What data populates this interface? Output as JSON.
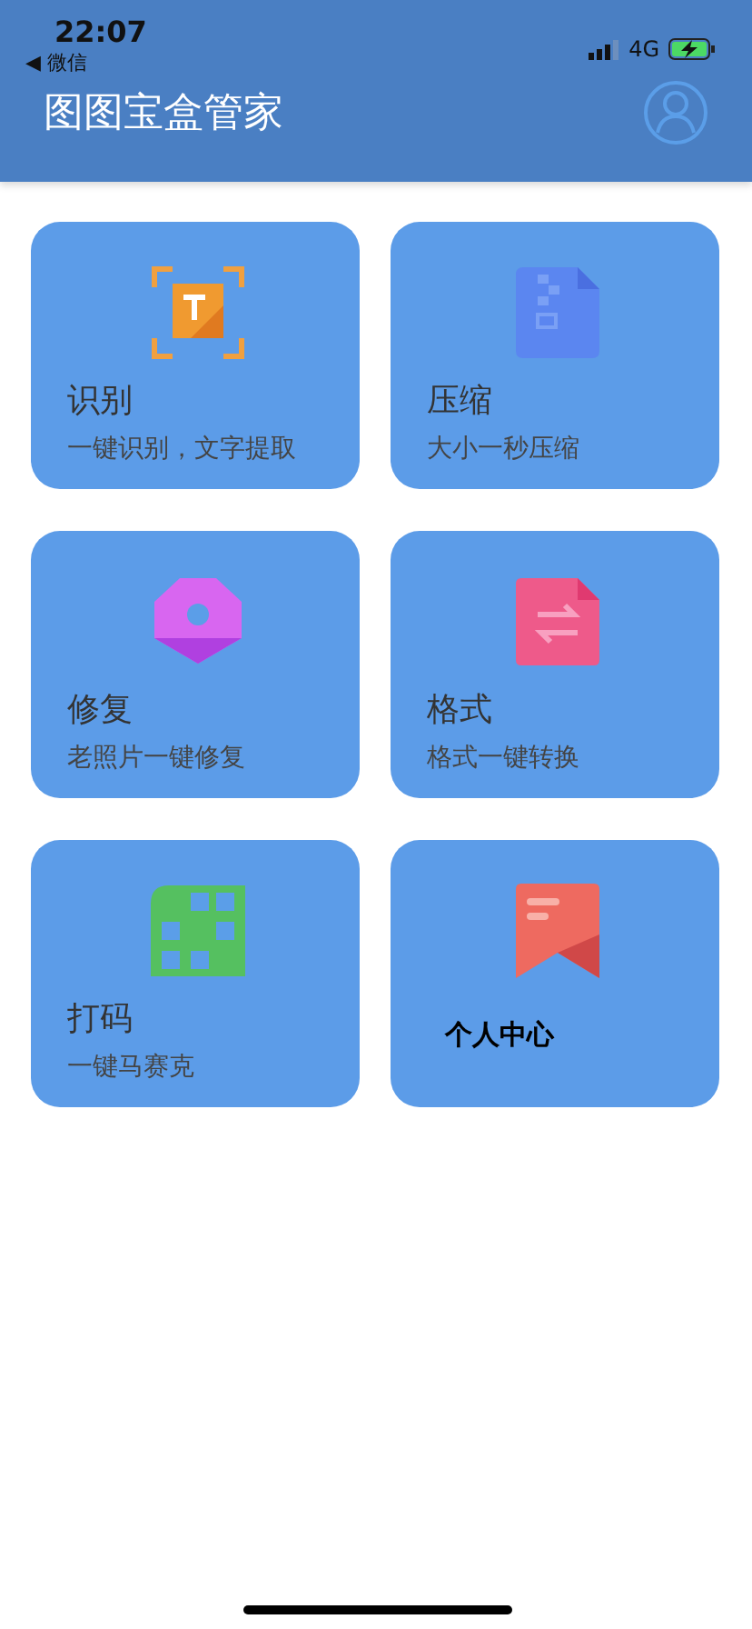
{
  "status_bar": {
    "time": "22:07",
    "back": "◀ 微信",
    "network": "4G",
    "charging": true
  },
  "header": {
    "title": "图图宝盒管家"
  },
  "cards": [
    {
      "kind": "feature",
      "title": "识别",
      "subtitle": "一键识别，文字提取"
    },
    {
      "kind": "feature",
      "title": "压缩",
      "subtitle": "大小一秒压缩"
    },
    {
      "kind": "feature",
      "title": "修复",
      "subtitle": "老照片一键修复"
    },
    {
      "kind": "feature",
      "title": "格式",
      "subtitle": "格式一键转换"
    },
    {
      "kind": "feature",
      "title": "打码",
      "subtitle": "一键马赛克"
    },
    {
      "kind": "plain",
      "title": "个人中心"
    }
  ]
}
